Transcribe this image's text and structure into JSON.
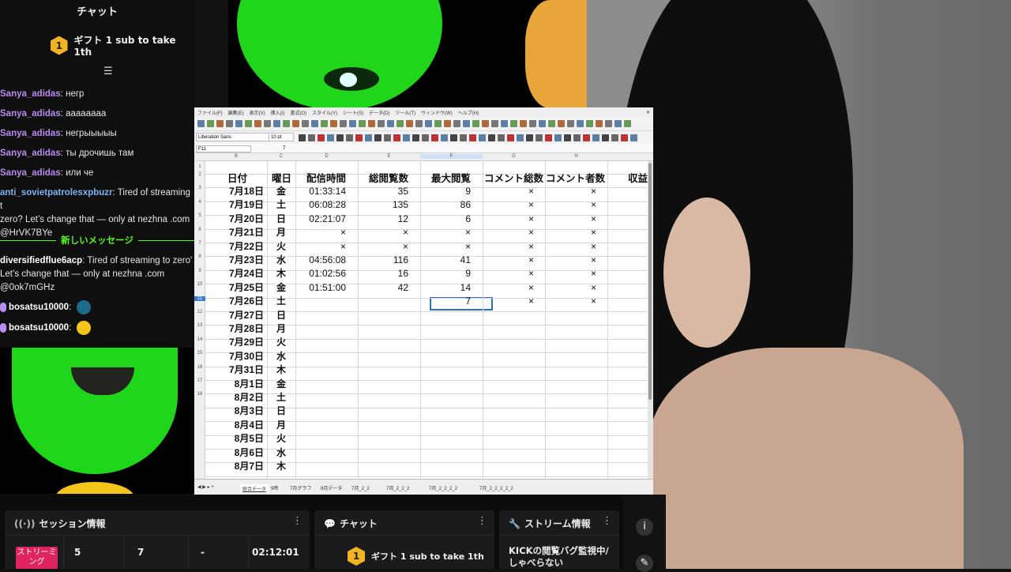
{
  "chat": {
    "title": "チャット",
    "gift": {
      "badge": "1",
      "text": "ギフト 1 sub to take 1th"
    },
    "messages": [
      {
        "user": "Sanya_adidas",
        "text": ": негр"
      },
      {
        "user": "Sanya_adidas",
        "text": ": аааааааа"
      },
      {
        "user": "Sanya_adidas",
        "text": ": негрыыыыы"
      },
      {
        "user": "Sanya_adidas",
        "text": ": ты дрочишь там"
      },
      {
        "user": "Sanya_adidas",
        "text": ": или че"
      }
    ],
    "spam1": {
      "user": "anti_sovietpatrolesxpbuzr",
      "l1": ": Tired of streaming t",
      "l2": "zero? Let’s change that — only at nezhna .com",
      "l3": "@HrVK7BYe"
    },
    "new_messages": "新しいメッセージ",
    "spam2": {
      "user": "diversifiedflue6acp",
      "l1": ": Tired of streaming to zero'",
      "l2": "Let’s change that — only at nezhna .com",
      "l3": "@0ok7mGHz"
    },
    "emote_msgs": [
      {
        "user": "bosatsu10000",
        "sep": ":"
      },
      {
        "user": "bosatsu10000",
        "sep": ":"
      }
    ]
  },
  "sheet": {
    "menu": [
      "ファイル(F)",
      "編集(E)",
      "表示(V)",
      "挿入(I)",
      "書式(O)",
      "スタイル(Y)",
      "シート(S)",
      "データ(D)",
      "ツール(T)",
      "ウィンドウ(W)",
      "ヘルプ(H)"
    ],
    "font_name": "Liberation Sans",
    "font_size": "10 pt",
    "cell_ref": "F11",
    "formula": "7",
    "columns": [
      "B",
      "C",
      "D",
      "E",
      "F",
      "G",
      "H"
    ],
    "rows": [
      "1",
      "2",
      "3",
      "4",
      "5",
      "6",
      "7",
      "8",
      "9",
      "10",
      "11",
      "12",
      "13",
      "14",
      "15",
      "16",
      "17",
      "18"
    ],
    "headers": [
      "日付",
      "曜日",
      "配信時間",
      "総閲覧数",
      "最大閲覧",
      "コメント総数",
      "コメント者数",
      "収益"
    ],
    "data": [
      [
        "7月18日",
        "金",
        "01:33:14",
        "35",
        "9",
        "×",
        "×"
      ],
      [
        "7月19日",
        "土",
        "06:08:28",
        "135",
        "86",
        "×",
        "×"
      ],
      [
        "7月20日",
        "日",
        "02:21:07",
        "12",
        "6",
        "×",
        "×"
      ],
      [
        "7月21日",
        "月",
        "×",
        "×",
        "×",
        "×",
        "×"
      ],
      [
        "7月22日",
        "火",
        "×",
        "×",
        "×",
        "×",
        "×"
      ],
      [
        "7月23日",
        "水",
        "04:56:08",
        "116",
        "41",
        "×",
        "×"
      ],
      [
        "7月24日",
        "木",
        "01:02:56",
        "16",
        "9",
        "×",
        "×"
      ],
      [
        "7月25日",
        "金",
        "01:51:00",
        "42",
        "14",
        "×",
        "×"
      ],
      [
        "7月26日",
        "土",
        "",
        "",
        "7",
        "×",
        "×"
      ],
      [
        "7月27日",
        "日",
        "",
        "",
        "",
        "",
        ""
      ],
      [
        "7月28日",
        "月",
        "",
        "",
        "",
        "",
        ""
      ],
      [
        "7月29日",
        "火",
        "",
        "",
        "",
        "",
        ""
      ],
      [
        "7月30日",
        "水",
        "",
        "",
        "",
        "",
        ""
      ],
      [
        "7月31日",
        "木",
        "",
        "",
        "",
        "",
        ""
      ],
      [
        "8月1日",
        "金",
        "",
        "",
        "",
        "",
        ""
      ],
      [
        "8月2日",
        "土",
        "",
        "",
        "",
        "",
        ""
      ],
      [
        "8月3日",
        "日",
        "",
        "",
        "",
        "",
        ""
      ],
      [
        "8月4日",
        "月",
        "",
        "",
        "",
        "",
        ""
      ],
      [
        "8月5日",
        "火",
        "",
        "",
        "",
        "",
        ""
      ],
      [
        "8月6日",
        "水",
        "",
        "",
        "",
        "",
        ""
      ],
      [
        "8月7日",
        "木",
        "",
        "",
        "",
        "",
        ""
      ]
    ],
    "tabs": [
      "総合データ",
      "9時",
      "7月グラフ",
      "8月データ",
      "7月_2_2",
      "7月_2_2_2",
      "7月_2_2_2_2",
      "7月_2_2_2_2_2"
    ]
  },
  "session": {
    "title": "セッション情報",
    "live": "ストリーミング",
    "stat1": "5",
    "stat2": "7",
    "stat3": "-",
    "duration": "02:12:01"
  },
  "chat_panel": {
    "title": "チャット",
    "gift_badge": "1",
    "gift_text": "ギフト 1 sub to take 1th"
  },
  "stream_info": {
    "title": "ストリーム情報",
    "text1": "KICKの閲覧バグ監視中/",
    "text2": "しゃべらない"
  },
  "colors": {
    "accent": "#53fc18",
    "live": "#e0245e",
    "username": "#b98cf0",
    "spam_user": "#7ab3f2"
  }
}
